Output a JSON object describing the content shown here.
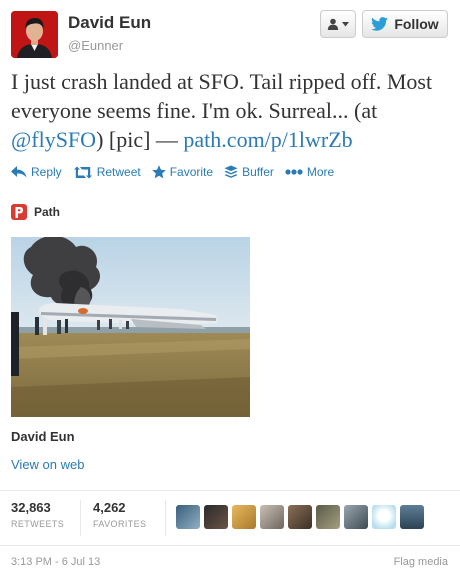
{
  "user": {
    "name": "David Eun",
    "handle": "@Eunner"
  },
  "buttons": {
    "follow_label": "Follow"
  },
  "tweet": {
    "part1": "I just crash landed at SFO. Tail ripped off. Most everyone seems fine. I'm ok. Surreal... (at ",
    "mention": "@flySFO",
    "part2": ") [pic] — ",
    "link": "path.com/p/1lwrZb"
  },
  "actions": [
    {
      "label": "Reply",
      "icon": "reply-icon"
    },
    {
      "label": "Retweet",
      "icon": "retweet-icon"
    },
    {
      "label": "Favorite",
      "icon": "star-icon"
    },
    {
      "label": "Buffer",
      "icon": "buffer-icon"
    },
    {
      "label": "More",
      "icon": "more-dots-icon"
    }
  ],
  "media": {
    "source_name": "Path",
    "author": "David Eun",
    "view_on_web": "View on web"
  },
  "stats": {
    "retweets_count": "32,863",
    "retweets_label": "RETWEETS",
    "favorites_count": "4,262",
    "favorites_label": "FAVORITES"
  },
  "footer": {
    "timestamp": "3:13 PM - 6 Jul 13",
    "flag": "Flag media"
  },
  "colors": {
    "link": "#2a7bb7",
    "text": "#333333",
    "muted": "#999999",
    "path_brand": "#d93a32"
  }
}
